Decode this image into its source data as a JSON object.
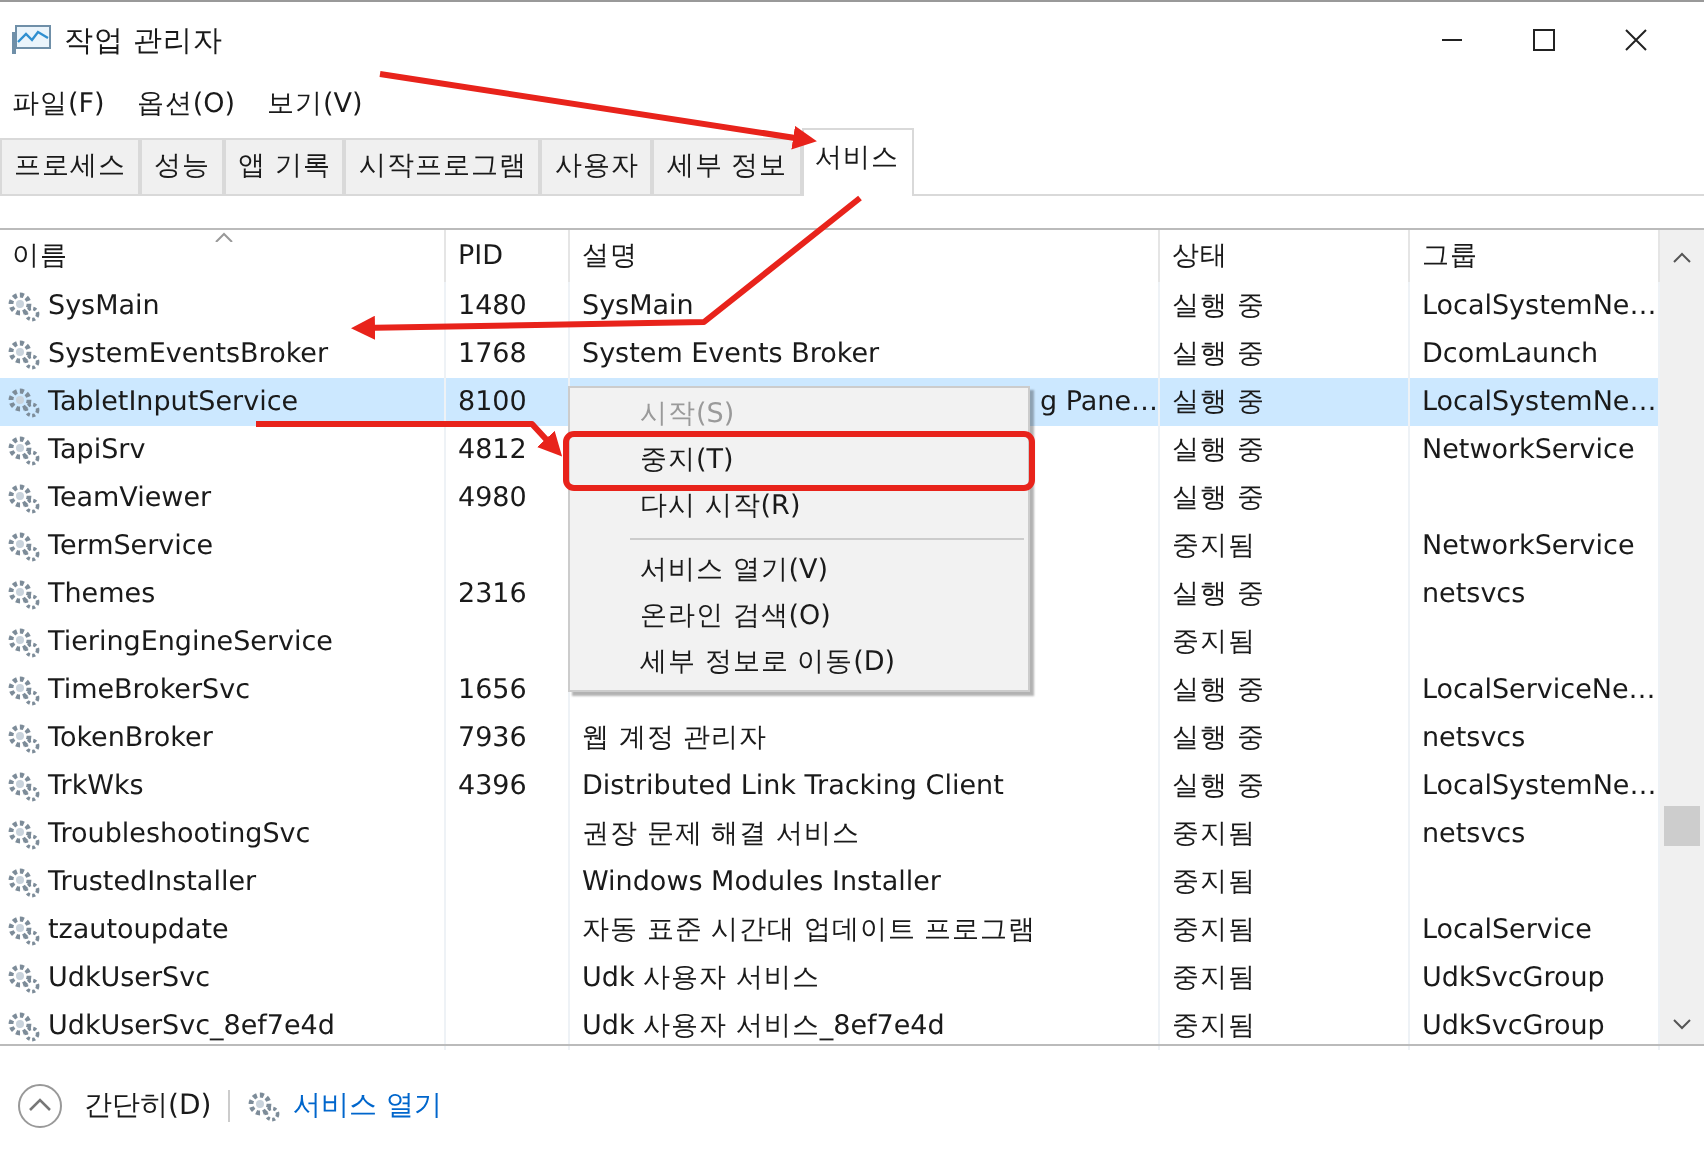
{
  "window": {
    "title": "작업 관리자"
  },
  "menu": [
    "파일(F)",
    "옵션(O)",
    "보기(V)"
  ],
  "tabs": [
    {
      "label": "프로세스",
      "selected": false
    },
    {
      "label": "성능",
      "selected": false
    },
    {
      "label": "앱 기록",
      "selected": false
    },
    {
      "label": "시작프로그램",
      "selected": false
    },
    {
      "label": "사용자",
      "selected": false
    },
    {
      "label": "세부 정보",
      "selected": false
    },
    {
      "label": "서비스",
      "selected": true
    }
  ],
  "table": {
    "columns": [
      "이름",
      "PID",
      "설명",
      "상태",
      "그룹"
    ],
    "rows": [
      {
        "name": "SysMain",
        "pid": "1480",
        "description": "SysMain",
        "status": "실행 중",
        "group": "LocalSystemNe…",
        "selected": false
      },
      {
        "name": "SystemEventsBroker",
        "pid": "1768",
        "description": "System Events Broker",
        "status": "실행 중",
        "group": "DcomLaunch",
        "selected": false
      },
      {
        "name": "TabletInputService",
        "pid": "8100",
        "description": "g Pane…",
        "status": "실행 중",
        "group": "LocalSystemNe…",
        "selected": true
      },
      {
        "name": "TapiSrv",
        "pid": "4812",
        "status": "실행 중",
        "group": "NetworkService",
        "selected": false
      },
      {
        "name": "TeamViewer",
        "pid": "4980",
        "status": "실행 중",
        "selected": false
      },
      {
        "name": "TermService",
        "status": "중지됨",
        "group": "NetworkService",
        "selected": false
      },
      {
        "name": "Themes",
        "pid": "2316",
        "status": "실행 중",
        "group": "netsvcs",
        "selected": false
      },
      {
        "name": "TieringEngineService",
        "status": "중지됨",
        "selected": false
      },
      {
        "name": "TimeBrokerSvc",
        "pid": "1656",
        "status": "실행 중",
        "group": "LocalServiceNe…",
        "selected": false
      },
      {
        "name": "TokenBroker",
        "pid": "7936",
        "description": "웹 계정 관리자",
        "status": "실행 중",
        "group": "netsvcs",
        "selected": false
      },
      {
        "name": "TrkWks",
        "pid": "4396",
        "description": "Distributed Link Tracking Client",
        "status": "실행 중",
        "group": "LocalSystemNe…",
        "selected": false
      },
      {
        "name": "TroubleshootingSvc",
        "description": "권장 문제 해결 서비스",
        "status": "중지됨",
        "group": "netsvcs",
        "selected": false
      },
      {
        "name": "TrustedInstaller",
        "description": "Windows Modules Installer",
        "status": "중지됨",
        "selected": false
      },
      {
        "name": "tzautoupdate",
        "description": "자동 표준 시간대 업데이트 프로그램",
        "status": "중지됨",
        "group": "LocalService",
        "selected": false
      },
      {
        "name": "UdkUserSvc",
        "description": "Udk 사용자 서비스",
        "status": "중지됨",
        "group": "UdkSvcGroup",
        "selected": false
      },
      {
        "name": "UdkUserSvc_8ef7e4d",
        "description": "Udk 사용자 서비스_8ef7e4d",
        "status": "중지됨",
        "group": "UdkSvcGroup",
        "selected": false
      }
    ]
  },
  "context_menu": [
    {
      "kind": "item",
      "label": "시작(S)",
      "disabled": true
    },
    {
      "kind": "item",
      "label": "중지(T)",
      "disabled": false
    },
    {
      "kind": "item",
      "label": "다시 시작(R)",
      "disabled": false
    },
    {
      "kind": "separator"
    },
    {
      "kind": "item",
      "label": "서비스 열기(V)",
      "disabled": false
    },
    {
      "kind": "item",
      "label": "온라인 검색(O)",
      "disabled": false
    },
    {
      "kind": "item",
      "label": "세부 정보로 이동(D)",
      "disabled": false
    }
  ],
  "footer": {
    "collapse": "간단히(D)",
    "open_services": "서비스 열기"
  }
}
